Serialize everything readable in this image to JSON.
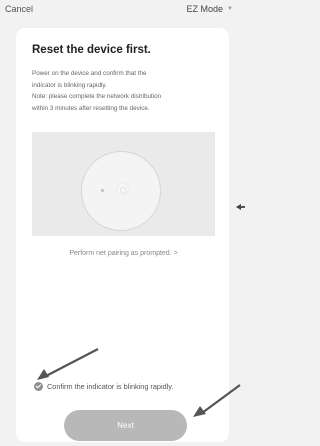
{
  "topbar": {
    "cancel_label": "Cancel",
    "mode_label": "EZ Mode",
    "mode_icon": "chevron-down-icon"
  },
  "content": {
    "title": "Reset the device first.",
    "description_lines": [
      "Power on the device and confirm that the",
      "indicator is blinking rapidly.",
      "Note: please complete the network distribution",
      "within 3 minutes after resetting the device."
    ],
    "illustration_icon": "device-indicator-icon",
    "prompt_link": "Perform net pairing as prompted. >"
  },
  "confirm": {
    "label": "Confirm the indicator is blinking rapidly.",
    "checked": true,
    "icon": "check-circle-icon"
  },
  "next_button": {
    "label": "Next",
    "enabled": false
  },
  "annotations": {
    "arrow_color": "#444444",
    "arrow_icons": [
      "annotation-arrow-icon",
      "annotation-arrow-icon",
      "annotation-arrow-icon"
    ]
  }
}
